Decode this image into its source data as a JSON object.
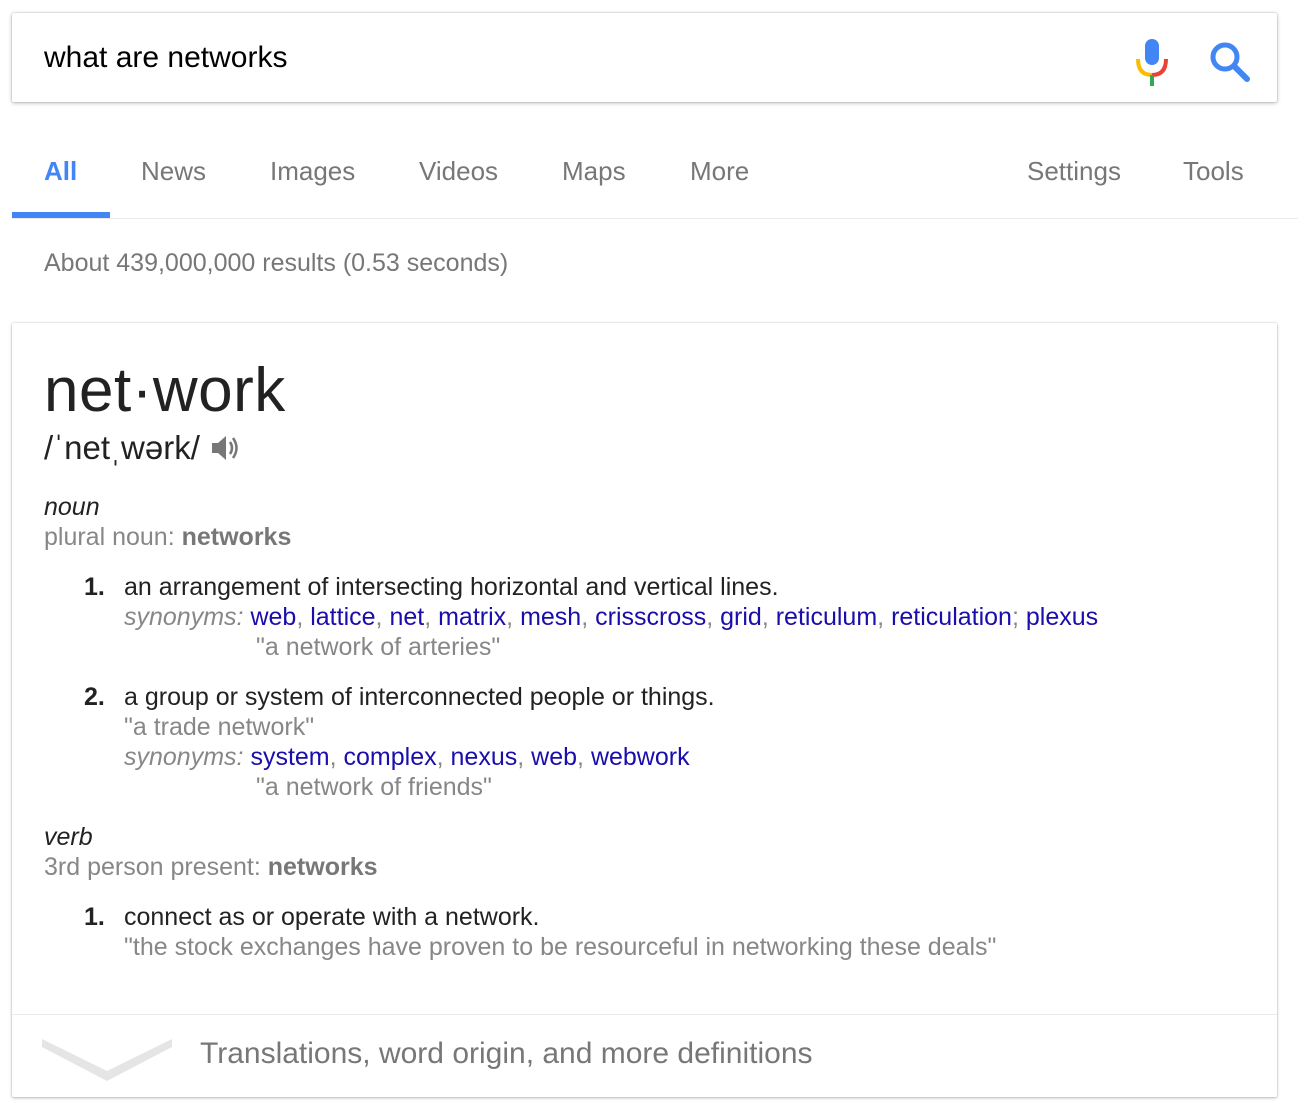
{
  "search": {
    "query": "what are networks"
  },
  "tabs": {
    "items": [
      {
        "label": "All"
      },
      {
        "label": "News"
      },
      {
        "label": "Images"
      },
      {
        "label": "Videos"
      },
      {
        "label": "Maps"
      },
      {
        "label": "More"
      },
      {
        "label": "Settings"
      },
      {
        "label": "Tools"
      }
    ],
    "active": "All"
  },
  "result_stats": "About 439,000,000 results (0.53 seconds)",
  "dictionary": {
    "headword": "net·work",
    "pronunciation": "/ˈnetˌwərk/",
    "noun": {
      "pos": "noun",
      "inflection_label": "plural noun: ",
      "inflection_value": "networks",
      "defs": [
        {
          "num": "1.",
          "text": "an arrangement of intersecting horizontal and vertical lines.",
          "synonyms_label": "synonyms:",
          "synonyms": [
            "web",
            "lattice",
            "net",
            "matrix",
            "mesh",
            "crisscross",
            "grid",
            "reticulum",
            "reticulation",
            "plexus"
          ],
          "example": "\"a network of arteries\""
        },
        {
          "num": "2.",
          "text": "a group or system of interconnected people or things.",
          "example_pre": "\"a trade network\"",
          "synonyms_label": "synonyms:",
          "synonyms": [
            "system",
            "complex",
            "nexus",
            "web",
            "webwork"
          ],
          "example": "\"a network of friends\""
        }
      ]
    },
    "verb": {
      "pos": "verb",
      "inflection_label": "3rd person present: ",
      "inflection_value": "networks",
      "defs": [
        {
          "num": "1.",
          "text": "connect as or operate with a network.",
          "example": "\"the stock exchanges have proven to be resourceful in networking these deals\""
        }
      ]
    },
    "footer_text": "Translations, word origin, and more definitions"
  },
  "colors": {
    "accent": "#4285f4",
    "link": "#1a0dab",
    "muted": "#878787"
  }
}
